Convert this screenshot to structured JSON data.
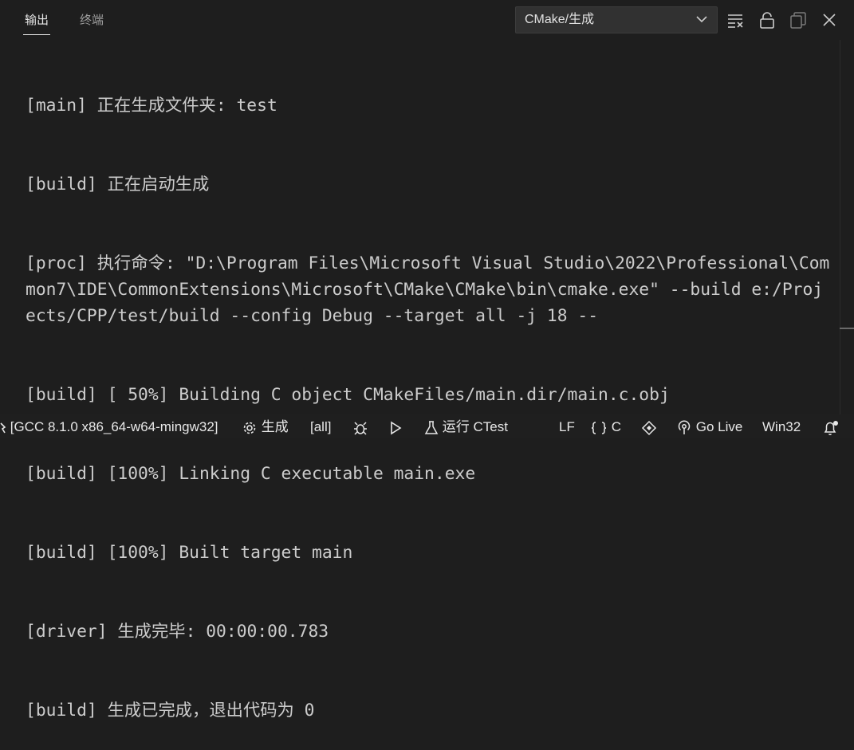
{
  "panel": {
    "tabs": [
      {
        "label": "输出",
        "active": true
      },
      {
        "label": "终端",
        "active": false
      }
    ],
    "channel_select": {
      "value": "CMake/生成"
    }
  },
  "output_lines": [
    "[main] 正在生成文件夹: test",
    "[build] 正在启动生成",
    "[proc] 执行命令: \"D:\\Program Files\\Microsoft Visual Studio\\2022\\Professional\\Common7\\IDE\\CommonExtensions\\Microsoft\\CMake\\CMake\\bin\\cmake.exe\" --build e:/Projects/CPP/test/build --config Debug --target all -j 18 --",
    "[build] [ 50%] Building C object CMakeFiles/main.dir/main.c.obj",
    "[build] [100%] Linking C executable main.exe",
    "[build] [100%] Built target main",
    "[driver] 生成完毕: 00:00:00.783",
    "[build] 生成已完成，退出代码为 0"
  ],
  "statusbar": {
    "kit": "[GCC 8.1.0 x86_64-w64-mingw32]",
    "build": "生成",
    "target": "[all]",
    "ctest": "运行 CTest",
    "eol": "LF",
    "language": "C",
    "golive": "Go Live",
    "platform": "Win32"
  },
  "icons": [
    "list-filter-icon",
    "lock-icon",
    "copy-icon",
    "close-icon",
    "gear-icon",
    "bug-icon",
    "play-icon",
    "flask-icon",
    "braces-icon",
    "sync-icon",
    "broadcast-icon",
    "bell-icon"
  ],
  "colors": {
    "background": "#1e1e1e",
    "text": "#cccccc",
    "statusbar": "#1f1f1f"
  }
}
